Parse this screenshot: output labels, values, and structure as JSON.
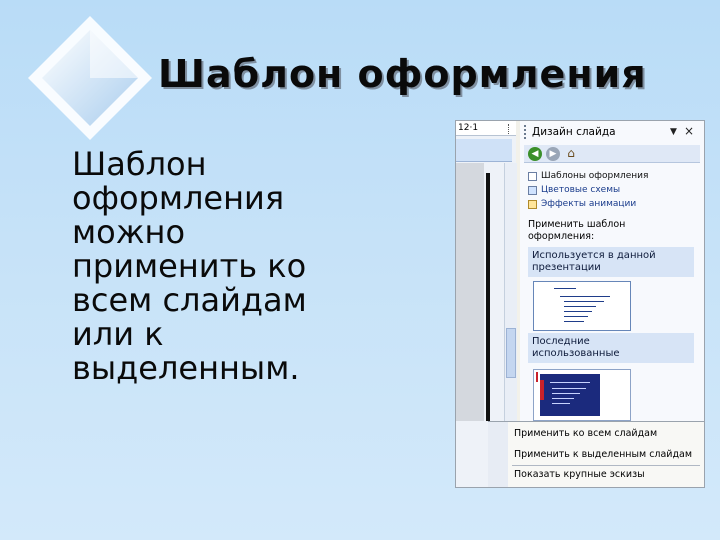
{
  "slide": {
    "title": "Шаблон оформления",
    "body_lines": [
      "Шаблон",
      "оформления",
      "можно",
      "применить ко",
      "всем слайдам",
      "или к",
      "выделенным."
    ]
  },
  "screenshot": {
    "ruler_text": "12·1",
    "task_pane": {
      "title": "Дизайн слайда",
      "dropdown_arrow": "▼",
      "close": "×",
      "nav_icons": [
        "back-icon",
        "forward-icon",
        "home-icon"
      ],
      "links": [
        "Шаблоны оформления",
        "Цветовые схемы",
        "Эффекты анимации"
      ],
      "apply_label_line1": "Применить шаблон",
      "apply_label_line2": "оформления:",
      "section_used_line1": "Используется в данной",
      "section_used_line2": "презентации",
      "section_recent_line1": "Последние",
      "section_recent_line2": "использованные"
    },
    "context_menu": {
      "items": [
        "Применить ко всем слайдам",
        "Применить к выделенным слайдам",
        "Показать крупные эскизы"
      ]
    }
  },
  "colors": {
    "background_top": "#b9dcf7",
    "background_bottom": "#d3e9fa",
    "section_header": "#d7e4f6",
    "link_blue": "#1a3c8c",
    "thumb_dark": "#1b2a7d"
  }
}
